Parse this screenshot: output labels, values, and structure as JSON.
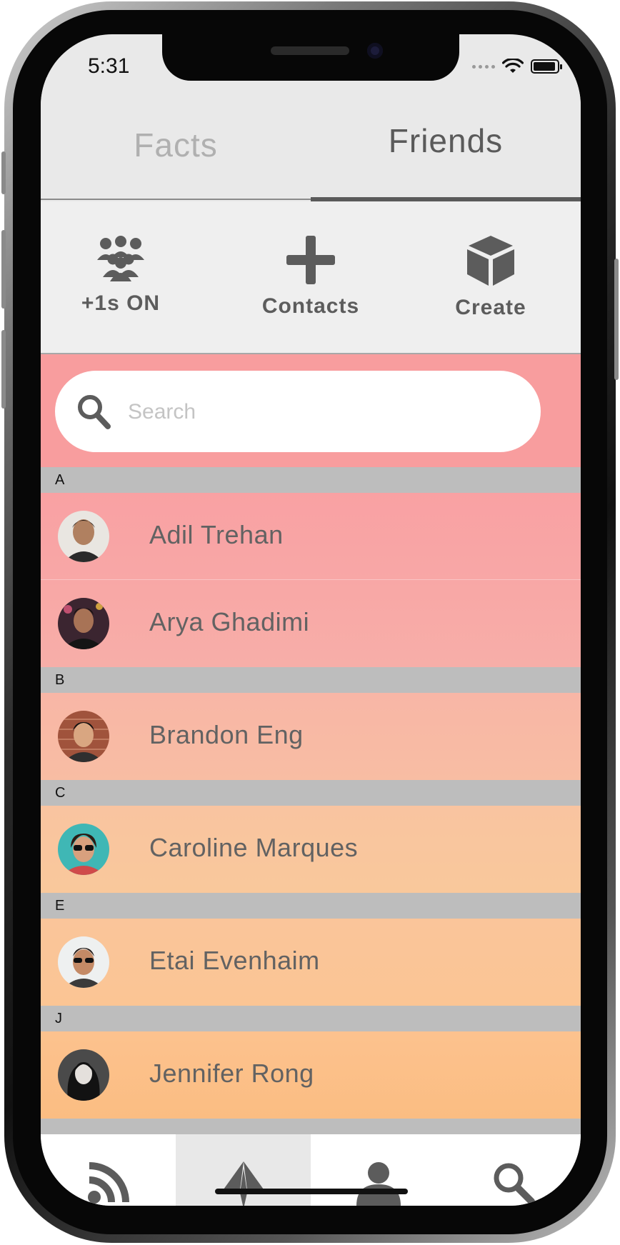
{
  "status_bar": {
    "time": "5:31"
  },
  "tabs": [
    {
      "label": "Facts",
      "active": false
    },
    {
      "label": "Friends",
      "active": true
    }
  ],
  "actions": [
    {
      "label": "+1s ON",
      "icon": "group-icon"
    },
    {
      "label": "Contacts",
      "icon": "plus-icon"
    },
    {
      "label": "Create",
      "icon": "cube-icon"
    }
  ],
  "search": {
    "placeholder": "Search",
    "value": ""
  },
  "sections": [
    {
      "letter": "A",
      "contacts": [
        {
          "name": "Adil Trehan"
        },
        {
          "name": "Arya Ghadimi"
        }
      ]
    },
    {
      "letter": "B",
      "contacts": [
        {
          "name": "Brandon Eng"
        }
      ]
    },
    {
      "letter": "C",
      "contacts": [
        {
          "name": "Caroline Marques"
        }
      ]
    },
    {
      "letter": "E",
      "contacts": [
        {
          "name": "Etai Evenhaim"
        }
      ]
    },
    {
      "letter": "J",
      "contacts": [
        {
          "name": "Jennifer Rong"
        }
      ]
    }
  ],
  "bottom_nav": [
    {
      "icon": "feed-icon",
      "active": false
    },
    {
      "icon": "paper-plane-icon",
      "active": true
    },
    {
      "icon": "profile-icon",
      "active": false
    },
    {
      "icon": "search-icon",
      "active": false
    }
  ],
  "colors": {
    "accent_top": "#f89d9e",
    "accent_bottom": "#fbbd80",
    "section_header": "#bdbdbd",
    "icon_gray": "#5c5c5c"
  }
}
